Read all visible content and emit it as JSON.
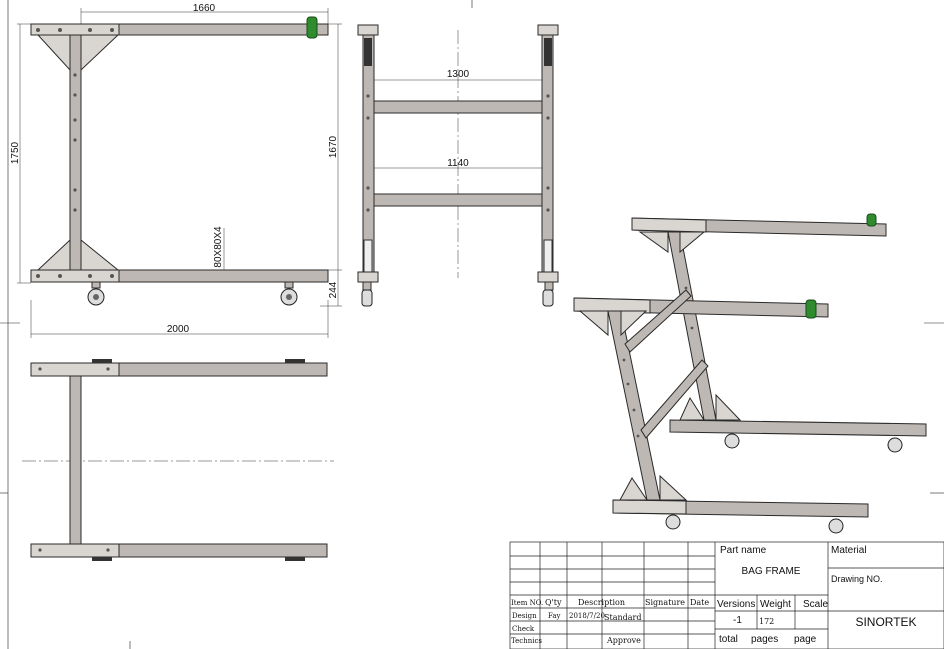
{
  "dimensions": {
    "front_top_length": "1660",
    "front_overall_height": "1750",
    "front_inner_height": "1670",
    "tube_profile": "80X80X4",
    "caster_height": "244",
    "overall_length": "2000",
    "side_top_span": "1300",
    "side_lower_span": "1140"
  },
  "title_block": {
    "part_name_label": "Part name",
    "part_name": "BAG FRAME",
    "material_label": "Material",
    "drawing_no_label": "Drawing NO.",
    "company": "SINORTEK",
    "versions_label": "Versions",
    "version_value": "-1",
    "weight_label": "Weight",
    "weight_value": "172",
    "scale_label": "Scale",
    "total_label": "total",
    "pages_label": "pages",
    "page_label": "page",
    "item_no_label": "Item NO.",
    "qty_label": "Q'ty",
    "description_label": "Description",
    "signature_label": "Signature",
    "date_label": "Date",
    "design_label": "Design",
    "designer": "Fay",
    "design_date": "2018/7/20",
    "standard_label": "Standard",
    "check_label": "Check",
    "technics_label": "Technics",
    "approve_label": "Approve"
  },
  "colors": {
    "tube_fill": "#bdb8b3",
    "accent_green": "#2e8b2e"
  }
}
